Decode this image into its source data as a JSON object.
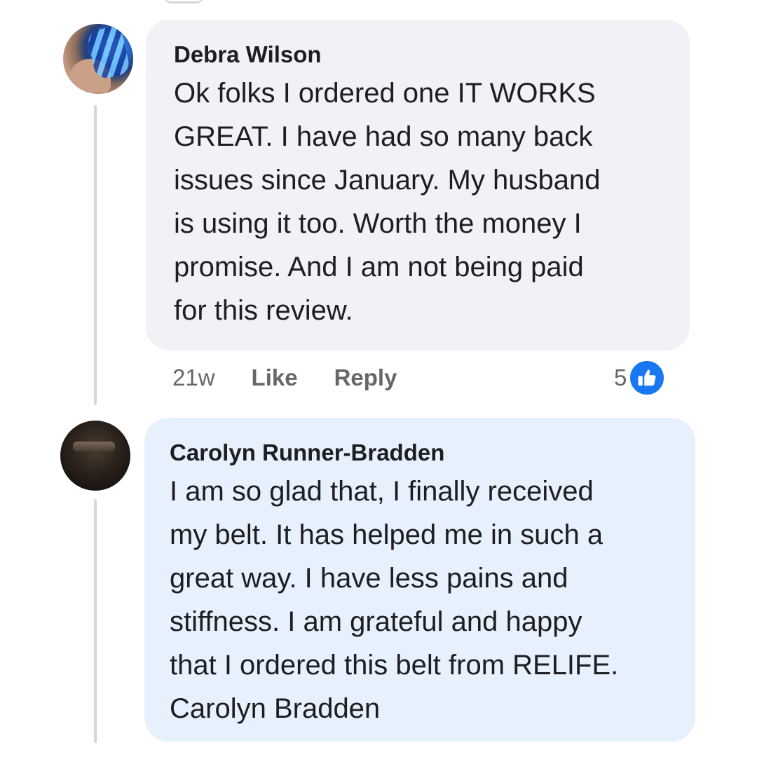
{
  "comments": [
    {
      "author": "Debra Wilson",
      "text": "Ok folks I ordered one IT WORKS\nGREAT. I have had so many back\nissues since January. My husband\nis using it too. Worth the money I\npromise. And I am not being paid\nfor this review.",
      "time": "21w",
      "like_label": "Like",
      "reply_label": "Reply",
      "reaction_count": "5",
      "reaction_icon": "thumbs-up-icon"
    },
    {
      "author": "Carolyn Runner-Bradden",
      "text": "I am so glad that, I finally received\nmy belt. It has helped me in such a\ngreat way. I have less pains and\nstiffness. I am grateful and happy\nthat I ordered this belt from RELIFE.\nCarolyn Bradden"
    }
  ],
  "colors": {
    "bubble_default": "#f0f2f5",
    "bubble_highlight": "#e7f0fd",
    "like_blue": "#1877f2",
    "secondary_text": "#65676b"
  }
}
